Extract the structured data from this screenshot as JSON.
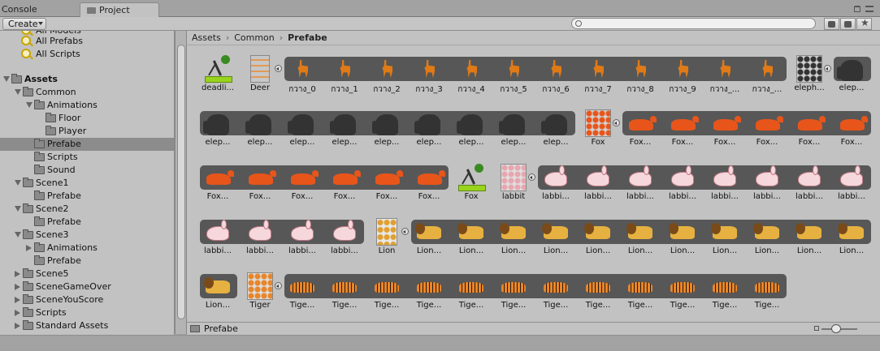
{
  "tabs": {
    "console": "Console",
    "project": "Project"
  },
  "toolbar": {
    "create_label": "Create",
    "search_placeholder": ""
  },
  "tree": {
    "partial_top": "All Models",
    "favorites": [
      "All Prefabs",
      "All Scripts"
    ],
    "items": [
      {
        "label": "Assets",
        "bold": true,
        "depth": 0,
        "state": "open"
      },
      {
        "label": "Common",
        "depth": 1,
        "state": "open"
      },
      {
        "label": "Animations",
        "depth": 2,
        "state": "open"
      },
      {
        "label": "Floor",
        "depth": 3,
        "state": "none"
      },
      {
        "label": "Player",
        "depth": 3,
        "state": "none"
      },
      {
        "label": "Prefabe",
        "depth": 2,
        "state": "none",
        "selected": true
      },
      {
        "label": "Scripts",
        "depth": 2,
        "state": "none"
      },
      {
        "label": "Sound",
        "depth": 2,
        "state": "none"
      },
      {
        "label": "Scene1",
        "depth": 1,
        "state": "open"
      },
      {
        "label": "Prefabe",
        "depth": 2,
        "state": "none"
      },
      {
        "label": "Scene2",
        "depth": 1,
        "state": "open"
      },
      {
        "label": "Prefabe",
        "depth": 2,
        "state": "none"
      },
      {
        "label": "Scene3",
        "depth": 1,
        "state": "open"
      },
      {
        "label": "Animations",
        "depth": 2,
        "state": "closed"
      },
      {
        "label": "Prefabe",
        "depth": 2,
        "state": "none"
      },
      {
        "label": "Scene5",
        "depth": 1,
        "state": "closed"
      },
      {
        "label": "SceneGameOver",
        "depth": 1,
        "state": "closed"
      },
      {
        "label": "SceneYouScore",
        "depth": 1,
        "state": "closed"
      },
      {
        "label": "Scripts",
        "depth": 1,
        "state": "closed"
      },
      {
        "label": "Standard Assets",
        "depth": 1,
        "state": "closed"
      }
    ]
  },
  "breadcrumb": [
    "Assets",
    "Common",
    "Prefabe"
  ],
  "grid_rows": [
    [
      {
        "name": "deadli...",
        "kind": "controller"
      },
      {
        "name": "Deer",
        "kind": "sheet-deer"
      },
      {
        "name": "กวาง_0",
        "kind": "deer",
        "strip": true
      },
      {
        "name": "กวาง_1",
        "kind": "deer",
        "strip": true
      },
      {
        "name": "กวาง_2",
        "kind": "deer",
        "strip": true
      },
      {
        "name": "กวาง_3",
        "kind": "deer",
        "strip": true
      },
      {
        "name": "กวาง_4",
        "kind": "deer",
        "strip": true
      },
      {
        "name": "กวาง_5",
        "kind": "deer",
        "strip": true
      },
      {
        "name": "กวาง_6",
        "kind": "deer",
        "strip": true
      },
      {
        "name": "กวาง_7",
        "kind": "deer",
        "strip": true
      },
      {
        "name": "กวาง_8",
        "kind": "deer",
        "strip": true
      },
      {
        "name": "กวาง_9",
        "kind": "deer",
        "strip": true
      },
      {
        "name": "กวาง_...",
        "kind": "deer",
        "strip": true
      },
      {
        "name": "กวาง_...",
        "kind": "deer",
        "strip": true
      },
      {
        "name": "eleph...",
        "kind": "sheet-ele"
      },
      {
        "name": "elep...",
        "kind": "ele",
        "strip": true
      }
    ],
    [
      {
        "name": "elep...",
        "kind": "ele",
        "strip": true
      },
      {
        "name": "elep...",
        "kind": "ele",
        "strip": true
      },
      {
        "name": "elep...",
        "kind": "ele",
        "strip": true
      },
      {
        "name": "elep...",
        "kind": "ele",
        "strip": true
      },
      {
        "name": "elep...",
        "kind": "ele",
        "strip": true
      },
      {
        "name": "elep...",
        "kind": "ele",
        "strip": true
      },
      {
        "name": "elep...",
        "kind": "ele",
        "strip": true
      },
      {
        "name": "elep...",
        "kind": "ele",
        "strip": true
      },
      {
        "name": "elep...",
        "kind": "ele",
        "strip": true
      },
      {
        "name": "Fox",
        "kind": "sheet-fox"
      },
      {
        "name": "Fox...",
        "kind": "fox",
        "strip": true
      },
      {
        "name": "Fox...",
        "kind": "fox",
        "strip": true
      },
      {
        "name": "Fox...",
        "kind": "fox",
        "strip": true
      },
      {
        "name": "Fox...",
        "kind": "fox",
        "strip": true
      },
      {
        "name": "Fox...",
        "kind": "fox",
        "strip": true
      },
      {
        "name": "Fox...",
        "kind": "fox",
        "strip": true
      }
    ],
    [
      {
        "name": "Fox...",
        "kind": "fox",
        "strip": true
      },
      {
        "name": "Fox...",
        "kind": "fox",
        "strip": true
      },
      {
        "name": "Fox...",
        "kind": "fox",
        "strip": true
      },
      {
        "name": "Fox...",
        "kind": "fox",
        "strip": true
      },
      {
        "name": "Fox...",
        "kind": "fox",
        "strip": true
      },
      {
        "name": "Fox...",
        "kind": "fox",
        "strip": true
      },
      {
        "name": "Fox",
        "kind": "controller"
      },
      {
        "name": "labbit",
        "kind": "sheet-rab"
      },
      {
        "name": "labbi...",
        "kind": "rab",
        "strip": true
      },
      {
        "name": "labbi...",
        "kind": "rab",
        "strip": true
      },
      {
        "name": "labbi...",
        "kind": "rab",
        "strip": true
      },
      {
        "name": "labbi...",
        "kind": "rab",
        "strip": true
      },
      {
        "name": "labbi...",
        "kind": "rab",
        "strip": true
      },
      {
        "name": "labbi...",
        "kind": "rab",
        "strip": true
      },
      {
        "name": "labbi...",
        "kind": "rab",
        "strip": true
      },
      {
        "name": "labbi...",
        "kind": "rab",
        "strip": true
      }
    ],
    [
      {
        "name": "labbi...",
        "kind": "rab",
        "strip": true
      },
      {
        "name": "labbi...",
        "kind": "rab",
        "strip": true
      },
      {
        "name": "labbi...",
        "kind": "rab",
        "strip": true
      },
      {
        "name": "labbi...",
        "kind": "rab",
        "strip": true
      },
      {
        "name": "Lion",
        "kind": "sheet-lion"
      },
      {
        "name": "Lion...",
        "kind": "lion",
        "strip": true
      },
      {
        "name": "Lion...",
        "kind": "lion",
        "strip": true
      },
      {
        "name": "Lion...",
        "kind": "lion",
        "strip": true
      },
      {
        "name": "Lion...",
        "kind": "lion",
        "strip": true
      },
      {
        "name": "Lion...",
        "kind": "lion",
        "strip": true
      },
      {
        "name": "Lion...",
        "kind": "lion",
        "strip": true
      },
      {
        "name": "Lion...",
        "kind": "lion",
        "strip": true
      },
      {
        "name": "Lion...",
        "kind": "lion",
        "strip": true
      },
      {
        "name": "Lion...",
        "kind": "lion",
        "strip": true
      },
      {
        "name": "Lion...",
        "kind": "lion",
        "strip": true
      },
      {
        "name": "Lion...",
        "kind": "lion",
        "strip": true
      }
    ],
    [
      {
        "name": "Lion...",
        "kind": "lion",
        "strip": true
      },
      {
        "name": "Tiger",
        "kind": "sheet-tiger"
      },
      {
        "name": "Tige...",
        "kind": "tiger",
        "strip": true
      },
      {
        "name": "Tige...",
        "kind": "tiger",
        "strip": true
      },
      {
        "name": "Tige...",
        "kind": "tiger",
        "strip": true
      },
      {
        "name": "Tige...",
        "kind": "tiger",
        "strip": true
      },
      {
        "name": "Tige...",
        "kind": "tiger",
        "strip": true
      },
      {
        "name": "Tige...",
        "kind": "tiger",
        "strip": true
      },
      {
        "name": "Tige...",
        "kind": "tiger",
        "strip": true
      },
      {
        "name": "Tige...",
        "kind": "tiger",
        "strip": true
      },
      {
        "name": "Tige...",
        "kind": "tiger",
        "strip": true
      },
      {
        "name": "Tige...",
        "kind": "tiger",
        "strip": true
      },
      {
        "name": "Tige...",
        "kind": "tiger",
        "strip": true
      },
      {
        "name": "Tige...",
        "kind": "tiger",
        "strip": true
      }
    ]
  ],
  "status": {
    "path": "Prefabe"
  },
  "colors": {
    "selection": "#8c8c8c",
    "strip": "#575757",
    "panel": "#c2c2c2"
  }
}
